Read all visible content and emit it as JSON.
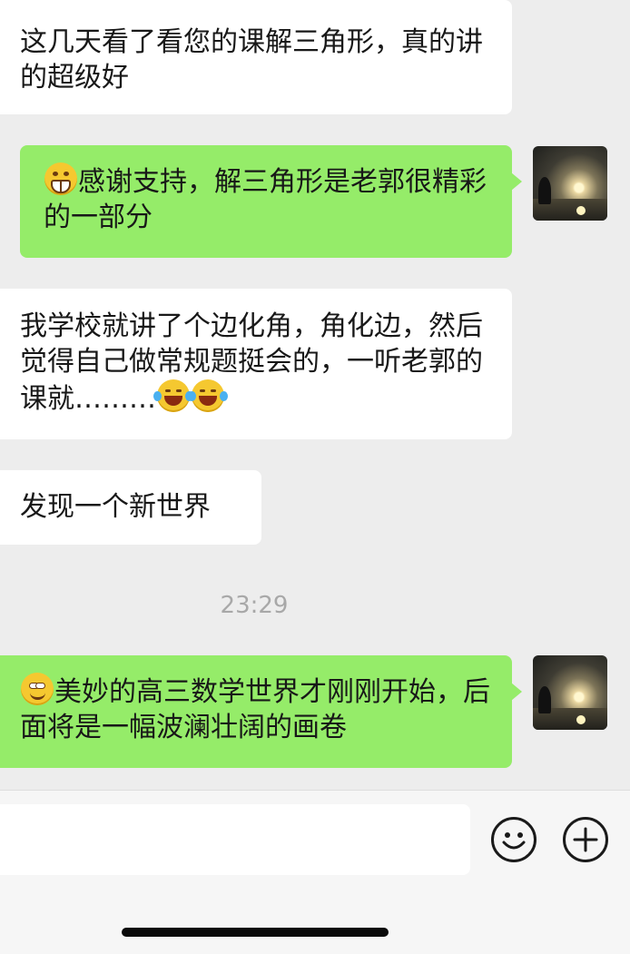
{
  "messages": [
    {
      "side": "in",
      "text": "这几天看了看您的课解三角形，真的讲的超级好"
    },
    {
      "side": "out",
      "emoji": "grin-emoji",
      "text": "感谢支持，解三角形是老郭很精彩的一部分"
    },
    {
      "side": "in",
      "text": "我学校就讲了个边化角，角化边，然后觉得自己做常规题挺会的，一听老郭的课就………",
      "trailing_emoji": [
        "laugh-emoji",
        "laugh-emoji"
      ]
    },
    {
      "side": "in",
      "text": "发现一个新世界"
    },
    {
      "side": "out",
      "emoji": "smirk-emoji",
      "text": "美妙的高三数学世界才刚刚开始，后面将是一幅波澜壮阔的画卷"
    }
  ],
  "timestamp": "23:29",
  "composer": {
    "input_value": "",
    "emoji_button": "smiley-icon",
    "more_button": "plus-icon"
  },
  "colors": {
    "background": "#ededed",
    "incoming_bubble": "#ffffff",
    "outgoing_bubble": "#95ec69",
    "timestamp_text": "#a8a8a8"
  }
}
